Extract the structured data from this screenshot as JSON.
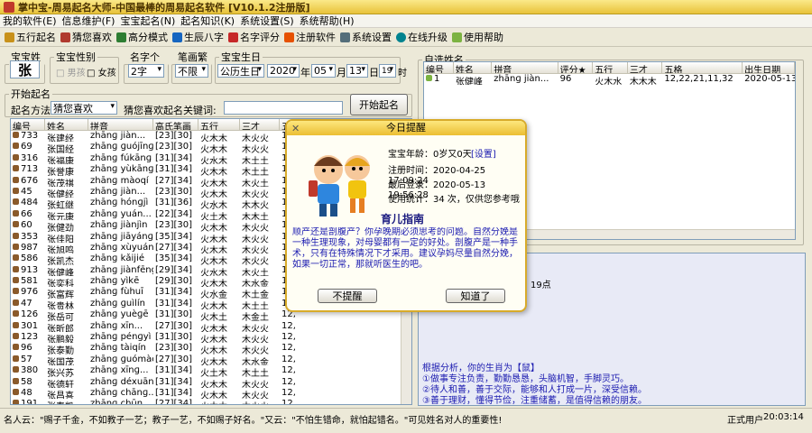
{
  "app": {
    "title": "掌中宝-周易起名大师-中国最棒的周易起名软件 [V10.1.2注册版]"
  },
  "menu": [
    "我的软件(E)",
    "信息维护(F)",
    "宝宝起名(N)",
    "起名知识(K)",
    "系统设置(S)",
    "系统帮助(H)"
  ],
  "toolbar": [
    {
      "label": "五行起名",
      "color": "#c8911a"
    },
    {
      "label": "猜您喜欢",
      "color": "#b03a2e"
    },
    {
      "label": "高分模式",
      "color": "#2e7d32"
    },
    {
      "label": "生辰八字",
      "color": "#1565c0"
    },
    {
      "label": "名字评分",
      "color": "#c62828"
    },
    {
      "label": "注册软件",
      "color": "#e65100"
    },
    {
      "label": "系统设置",
      "color": "#546e7a"
    },
    {
      "label": "在线升级",
      "color": "#00838f"
    },
    {
      "label": "使用帮助",
      "color": "#7cb342"
    }
  ],
  "surname": {
    "legend": "宝宝姓氏",
    "value": "张"
  },
  "gender": {
    "legend": "宝宝性别",
    "male": "男孩",
    "female": "女孩"
  },
  "count": {
    "legend": "名字个数",
    "value": "2字"
  },
  "strokes": {
    "legend": "笔画繁简",
    "value": "不限"
  },
  "birth": {
    "legend": "宝宝生日",
    "calendar": "公历生日",
    "year": "2020",
    "year_unit": "年",
    "month": "05",
    "month_unit": "月",
    "day": "13",
    "day_unit": "日",
    "hour": "19",
    "hour_unit": "时"
  },
  "start": {
    "legend": "开始起名",
    "method_label": "起名方法:",
    "method": "猜您喜欢",
    "keyword_label": "猜您喜欢起名关键词:",
    "button": "开始起名"
  },
  "names_table": {
    "headers": [
      "编号",
      "姓名",
      "拼音",
      "高氏笔画",
      "五行",
      "三才",
      "五格"
    ],
    "rows": [
      [
        "733",
        "张建经",
        "zhānɡ jiàn...",
        "[23][30]",
        "火木木",
        "木火火",
        "12,"
      ],
      [
        "69",
        "张国经",
        "zhānɡ ɡuójīnɡ",
        "[23][30]",
        "火木木",
        "木火火",
        "12,"
      ],
      [
        "316",
        "张福康",
        "zhānɡ fúkānɡ",
        "[31][34]",
        "火水木",
        "木土土",
        "12,"
      ],
      [
        "713",
        "张誉康",
        "zhānɡ yùkānɡ",
        "[31][34]",
        "火木木",
        "木土土",
        "12,"
      ],
      [
        "676",
        "张茂祺",
        "zhānɡ màoqí",
        "[27][34]",
        "火木木",
        "木火土",
        "12,"
      ],
      [
        "45",
        "张健经",
        "zhānɡ jiàn...",
        "[23][30]",
        "火木木",
        "木火火",
        "12,"
      ],
      [
        "484",
        "张虹继",
        "zhānɡ hónɡjì",
        "[31][36]",
        "火水木",
        "木木火",
        "12,"
      ],
      [
        "66",
        "张元康",
        "zhānɡ yuán...",
        "[22][34]",
        "火土木",
        "木木土",
        "12,"
      ],
      [
        "60",
        "张健劲",
        "zhānɡ jiànjìn",
        "[23][30]",
        "火木木",
        "木火火",
        "12,"
      ],
      [
        "353",
        "张佳阳",
        "zhānɡ jiāyánɡ",
        "[35][34]",
        "火木木",
        "木火火",
        "12,"
      ],
      [
        "987",
        "张旭鸣",
        "zhānɡ xùyuán",
        "[27][34]",
        "火木木",
        "木火火",
        "12,"
      ],
      [
        "586",
        "张凯杰",
        "zhānɡ kǎijié",
        "[35][34]",
        "火木木",
        "木火火",
        "12,"
      ],
      [
        "913",
        "张健峰",
        "zhānɡ jiànfēnɡ",
        "[29][34]",
        "火水木",
        "木火土",
        "12,"
      ],
      [
        "581",
        "张奕科",
        "zhānɡ yìkē",
        "[29][30]",
        "火木木",
        "木水金",
        "12,"
      ],
      [
        "976",
        "张富辉",
        "zhānɡ fùhuī",
        "[31][34]",
        "火水金",
        "木土金",
        "12,"
      ],
      [
        "47",
        "张贵林",
        "zhānɡ ɡuìlín",
        "[31][34]",
        "火木木",
        "木土土",
        "12,"
      ],
      [
        "126",
        "张岳可",
        "zhānɡ yuèɡē",
        "[31][30]",
        "火木土",
        "木金土",
        "12,"
      ],
      [
        "301",
        "张昕郎",
        "zhānɡ xīn...",
        "[27][30]",
        "火木木",
        "木火火",
        "12,"
      ],
      [
        "123",
        "张鹏毅",
        "zhānɡ pénɡyì",
        "[31][30]",
        "火木木",
        "木火火",
        "12,"
      ],
      [
        "96",
        "张泰勤",
        "zhānɡ tàiqín",
        "[23][30]",
        "火木木",
        "木火火",
        "12,"
      ],
      [
        "57",
        "张国茂",
        "zhānɡ ɡuómào",
        "[27][30]",
        "火木木",
        "木水金",
        "12,"
      ],
      [
        "380",
        "张兴苏",
        "zhānɡ xīnɡ...",
        "[31][34]",
        "火土木",
        "木土土",
        "12,"
      ],
      [
        "58",
        "张德轩",
        "zhānɡ déxuān",
        "[31][34]",
        "火木木",
        "木火火",
        "12,"
      ],
      [
        "48",
        "张昌喜",
        "zhānɡ chānɡ...",
        "[31][34]",
        "火木木",
        "木火火",
        "12,"
      ],
      [
        "191",
        "张春凯",
        "zhānɡ chūn...",
        "[27][34]",
        "火木木",
        "木火火",
        "12,"
      ]
    ]
  },
  "selected": {
    "legend": "自选姓名",
    "headers": [
      "编号",
      "姓名",
      "拼音",
      "评分★",
      "五行",
      "三才",
      "五格",
      "出生日期"
    ],
    "row": [
      "1",
      "张健峰",
      "zhānɡ jiàn...",
      "96",
      "火木水",
      "木木木",
      "12,22,21,11,32",
      "2020-05-13 19..."
    ]
  },
  "popup": {
    "title": "今日提醒",
    "age_label": "宝宝年龄：",
    "age": "0岁又0天",
    "settings": "[设置]",
    "reg_label": "注册时间：",
    "reg": "2020-04-25 17:09:24",
    "last_label": "最后登录：",
    "last": "2020-05-13 19:56:28",
    "use_label": "使用统计：",
    "use": "34 次，仅供您参考哦",
    "guide": "育儿指南",
    "text": "顺产还是剖腹产？你孕晚期必须思考的问题。自然分娩是一种生理现象，对母婴都有一定的好处。剖腹产是一种手术，只有在特殊情况下才采用。建议孕妈尽量自然分娩，如果一切正常，那就听医生的吧。",
    "btn_no": "不提醒",
    "btn_ok": "知道了"
  },
  "lower": {
    "score": "19点",
    "analysis": "根据分析，你的生肖为【鼠】",
    "lines": [
      "①做事专注负责，勤勤恳恳，头脑机智，手脚灵巧。",
      "②待人和善，善于交际，能够和人打成一片，深受信赖。",
      "③善于理财，懂得节俭，注重储蓄，是值得信赖的朋友。"
    ]
  },
  "status": {
    "left": "名人云：\"赐子千金，不如教子一艺；教子一艺，不如赐子好名。\"又云：\"不怕生错命，就怕起错名。\"可见姓名对人的重要性!",
    "user": "正式用户",
    "time": "20:03:14"
  }
}
